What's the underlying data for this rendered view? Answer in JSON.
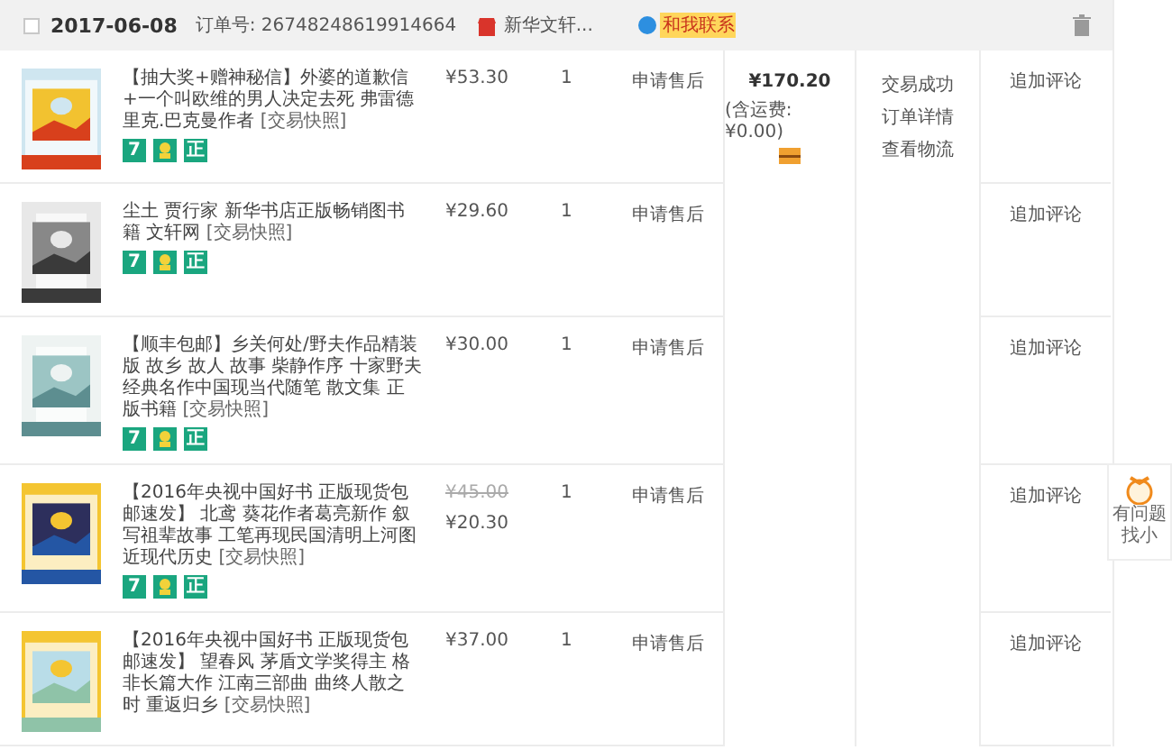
{
  "order": {
    "checked": false,
    "date": "2017-06-08",
    "order_no": "订单号: 26748248619914664",
    "shop": "新华文轩...",
    "contact": "和我联系"
  },
  "items": [
    {
      "title": "【抽大奖+赠神秘信】外婆的道歉信+一个叫欧维的男人决定去死 弗雷德里克.巴克曼作者",
      "snapshot": "[交易快照]",
      "price": "¥53.30",
      "qty": "1",
      "after_sale": "申请售后",
      "action": "追加评论",
      "badges": [
        {
          "kind": "text",
          "text": "7"
        },
        {
          "kind": "icon"
        },
        {
          "kind": "text",
          "text": "正"
        }
      ]
    },
    {
      "title": "尘土 贾行家 新华书店正版畅销图书籍 文轩网",
      "snapshot": "[交易快照]",
      "price": "¥29.60",
      "qty": "1",
      "after_sale": "申请售后",
      "action": "追加评论",
      "badges": [
        {
          "kind": "text",
          "text": "7"
        },
        {
          "kind": "icon"
        },
        {
          "kind": "text",
          "text": "正"
        }
      ]
    },
    {
      "title": "【顺丰包邮】乡关何处/野夫作品精装版 故乡 故人 故事 柴静作序 十家野夫经典名作中国现当代随笔 散文集 正版书籍",
      "snapshot": "[交易快照]",
      "price": "¥30.00",
      "qty": "1",
      "after_sale": "申请售后",
      "action": "追加评论",
      "badges": [
        {
          "kind": "text",
          "text": "7"
        },
        {
          "kind": "icon"
        },
        {
          "kind": "text",
          "text": "正"
        }
      ]
    },
    {
      "title": "【2016年央视中国好书 正版现货包邮速发】 北鸢 葵花作者葛亮新作 叙写祖辈故事 工笔再现民国清明上河图近现代历史",
      "snapshot": "[交易快照]",
      "old_price": "¥45.00",
      "price": "¥20.30",
      "qty": "1",
      "after_sale": "申请售后",
      "action": "追加评论",
      "badges": [
        {
          "kind": "text",
          "text": "7"
        },
        {
          "kind": "icon"
        },
        {
          "kind": "text",
          "text": "正"
        }
      ]
    },
    {
      "title": "【2016年央视中国好书 正版现货包邮速发】 望春风 茅盾文学奖得主 格非长篇大作 江南三部曲 曲终人散之时 重返归乡",
      "snapshot": "[交易快照]",
      "price": "¥37.00",
      "qty": "1",
      "after_sale": "申请售后",
      "action": "追加评论"
    }
  ],
  "total": {
    "amount": "¥170.20",
    "shipping": "(含运费: ¥0.00)"
  },
  "status": [
    "交易成功",
    "订单详情",
    "查看物流"
  ],
  "helper": {
    "lines": [
      "有问题",
      "找小"
    ]
  }
}
